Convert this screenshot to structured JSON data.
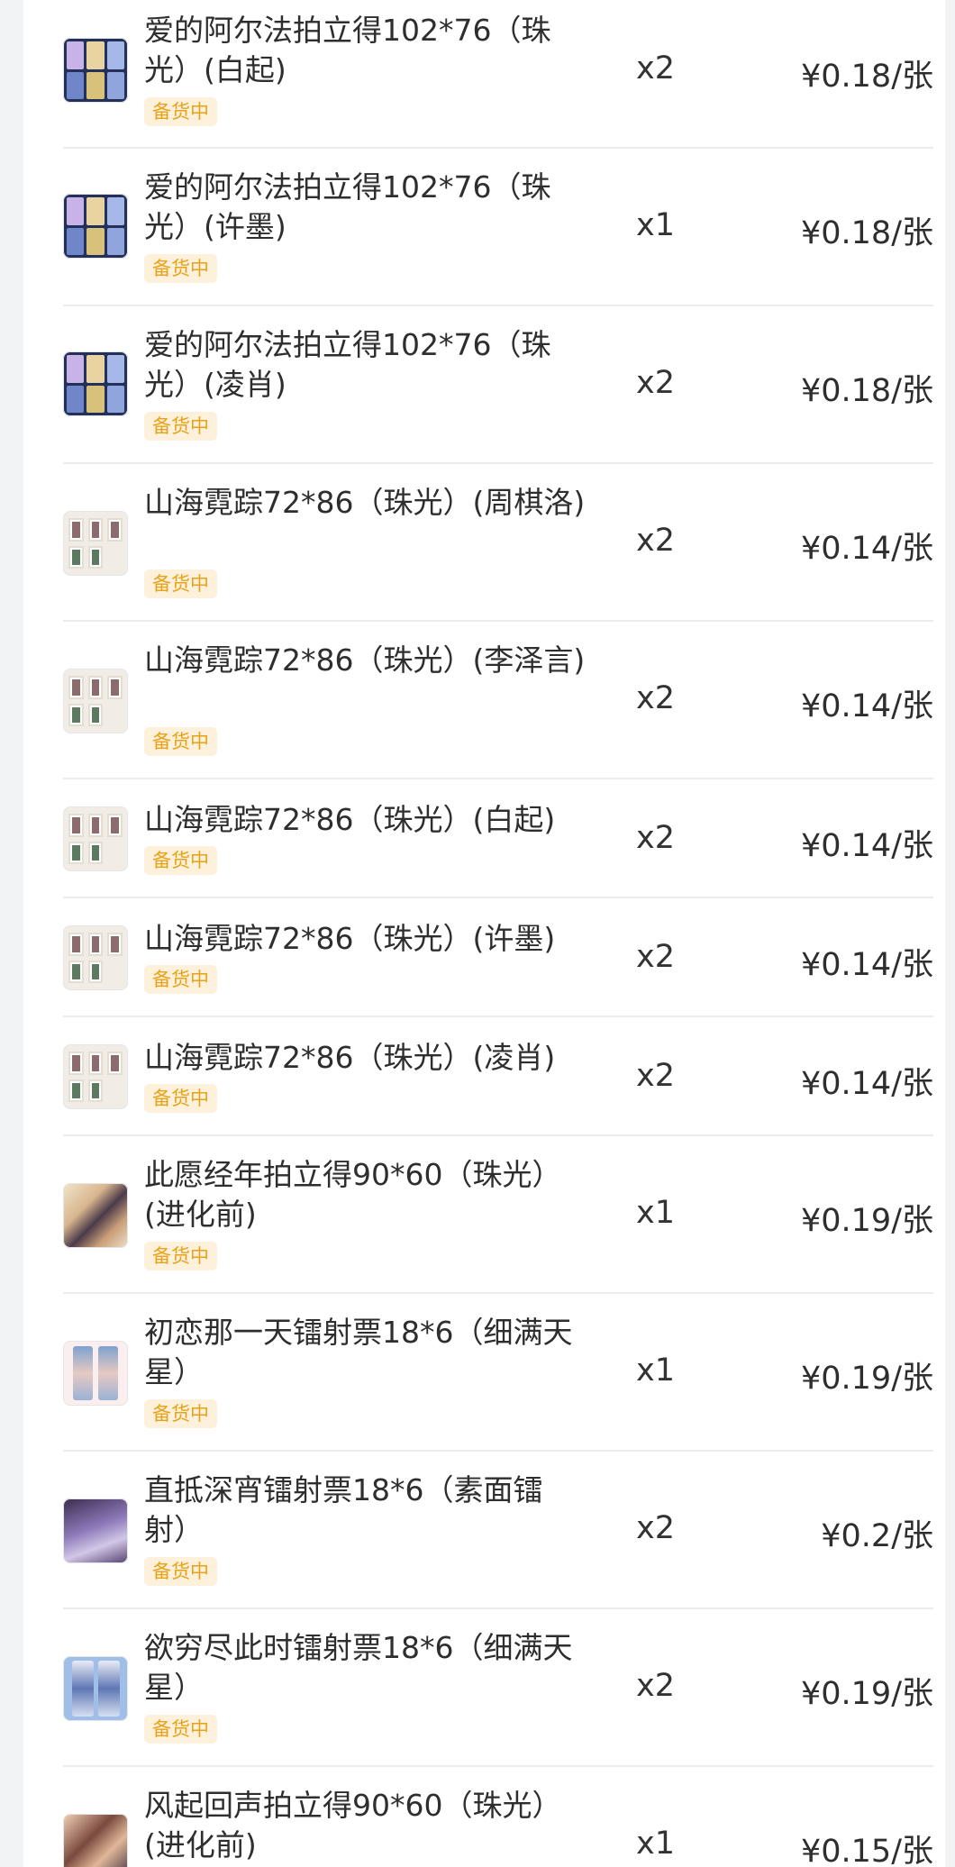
{
  "status_label": "备货中",
  "items": [
    {
      "title": "爱的阿尔法拍立得102*76（珠光）(白起)",
      "qty": "x2",
      "price": "¥0.18/张",
      "thumb_icon": "polaroid-grid-thumbnail"
    },
    {
      "title": "爱的阿尔法拍立得102*76（珠光）(许墨)",
      "qty": "x1",
      "price": "¥0.18/张",
      "thumb_icon": "polaroid-grid-thumbnail"
    },
    {
      "title": "爱的阿尔法拍立得102*76（珠光）(凌肖)",
      "qty": "x2",
      "price": "¥0.18/张",
      "thumb_icon": "polaroid-grid-thumbnail"
    },
    {
      "title": "山海霓踪72*86（珠光）(周棋洛)",
      "qty": "x2",
      "price": "¥0.14/张",
      "thumb_icon": "card-set-thumbnail"
    },
    {
      "title": "山海霓踪72*86（珠光）(李泽言)",
      "qty": "x2",
      "price": "¥0.14/张",
      "thumb_icon": "card-set-thumbnail"
    },
    {
      "title": "山海霓踪72*86（珠光）(白起)",
      "qty": "x2",
      "price": "¥0.14/张",
      "thumb_icon": "card-set-thumbnail"
    },
    {
      "title": "山海霓踪72*86（珠光）(许墨)",
      "qty": "x2",
      "price": "¥0.14/张",
      "thumb_icon": "card-set-thumbnail"
    },
    {
      "title": "山海霓踪72*86（珠光）(凌肖)",
      "qty": "x2",
      "price": "¥0.14/张",
      "thumb_icon": "card-set-thumbnail"
    },
    {
      "title": "此愿经年拍立得90*60（珠光）(进化前)",
      "qty": "x1",
      "price": "¥0.19/张",
      "thumb_icon": "polaroid-thumbnail"
    },
    {
      "title": "初恋那一天镭射票18*6（细满天星）",
      "qty": "x1",
      "price": "¥0.19/张",
      "thumb_icon": "ticket-thumbnail"
    },
    {
      "title": "直抵深宵镭射票18*6（素面镭射）",
      "qty": "x2",
      "price": "¥0.2/张",
      "thumb_icon": "ticket-thumbnail"
    },
    {
      "title": "欲穷尽此时镭射票18*6（细满天星）",
      "qty": "x2",
      "price": "¥0.19/张",
      "thumb_icon": "ticket-thumbnail"
    },
    {
      "title": "风起回声拍立得90*60（珠光）(进化前)",
      "qty": "x1",
      "price": "¥0.15/张",
      "thumb_icon": "polaroid-thumbnail"
    }
  ]
}
